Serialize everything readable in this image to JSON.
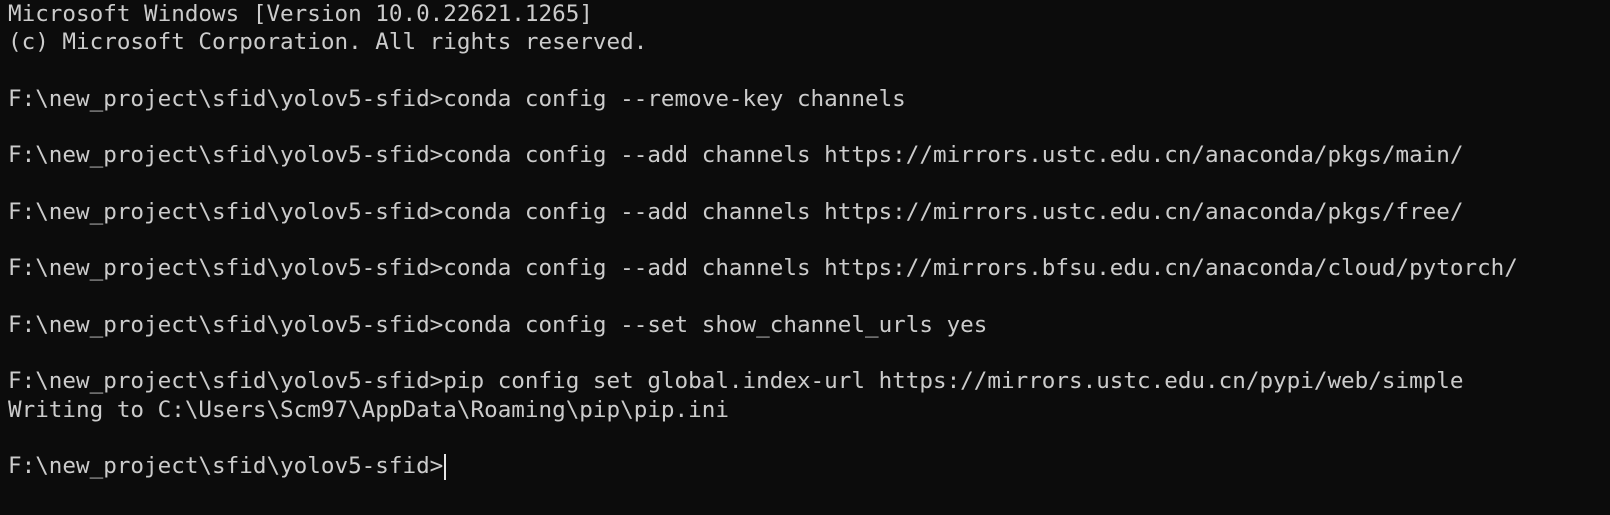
{
  "terminal": {
    "lines": [
      "Microsoft Windows [Version 10.0.22621.1265]",
      "(c) Microsoft Corporation. All rights reserved.",
      "",
      "F:\\new_project\\sfid\\yolov5-sfid>conda config --remove-key channels",
      "",
      "F:\\new_project\\sfid\\yolov5-sfid>conda config --add channels https://mirrors.ustc.edu.cn/anaconda/pkgs/main/",
      "",
      "F:\\new_project\\sfid\\yolov5-sfid>conda config --add channels https://mirrors.ustc.edu.cn/anaconda/pkgs/free/",
      "",
      "F:\\new_project\\sfid\\yolov5-sfid>conda config --add channels https://mirrors.bfsu.edu.cn/anaconda/cloud/pytorch/",
      "",
      "F:\\new_project\\sfid\\yolov5-sfid>conda config --set show_channel_urls yes",
      "",
      "F:\\new_project\\sfid\\yolov5-sfid>pip config set global.index-url https://mirrors.ustc.edu.cn/pypi/web/simple",
      "Writing to C:\\Users\\Scm97\\AppData\\Roaming\\pip\\pip.ini",
      ""
    ],
    "prompt": "F:\\new_project\\sfid\\yolov5-sfid>",
    "colors": {
      "background": "#0c0c0c",
      "foreground": "#cccccc"
    }
  }
}
